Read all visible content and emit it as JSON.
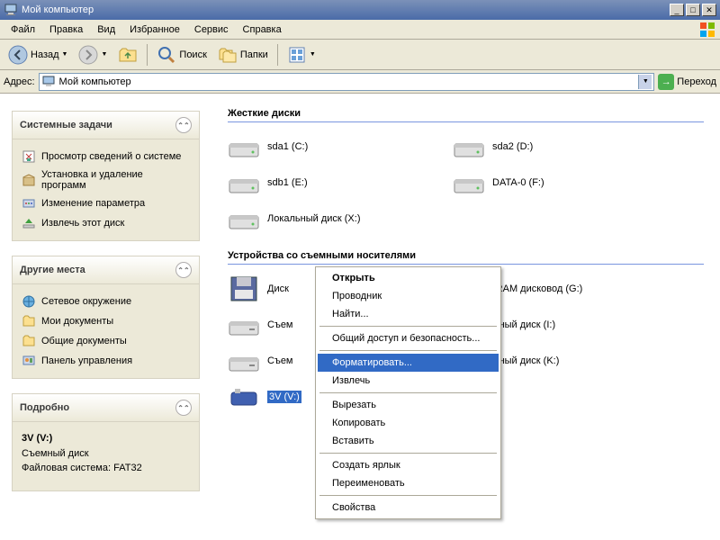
{
  "title": "Мой компьютер",
  "menu": [
    "Файл",
    "Правка",
    "Вид",
    "Избранное",
    "Сервис",
    "Справка"
  ],
  "toolbar": {
    "back": "Назад",
    "search": "Поиск",
    "folders": "Папки"
  },
  "address": {
    "label": "Адрес:",
    "value": "Мой компьютер",
    "go": "Переход"
  },
  "tasks": {
    "title": "Системные задачи",
    "items": [
      "Просмотр сведений о системе",
      "Установка и удаление программ",
      "Изменение параметра",
      "Извлечь этот диск"
    ]
  },
  "places": {
    "title": "Другие места",
    "items": [
      "Сетевое окружение",
      "Мои документы",
      "Общие документы",
      "Панель управления"
    ]
  },
  "details": {
    "title": "Подробно",
    "name": "3V (V:)",
    "type": "Съемный диск",
    "fs": "Файловая система: FAT32"
  },
  "groups": {
    "hdd": "Жесткие диски",
    "dev": "Устройства со съемными носителями"
  },
  "hdd": [
    {
      "label": "sda1 (C:)"
    },
    {
      "label": "sda2 (D:)"
    },
    {
      "label": "sdb1 (E:)"
    },
    {
      "label": "DATA-0 (F:)"
    },
    {
      "label": "Локальный диск (X:)"
    }
  ],
  "dev": [
    {
      "label": "Диск",
      "type": "floppy"
    },
    {
      "label": "-RAM дисковод (G:)",
      "type": "cd"
    },
    {
      "label": "Съем",
      "type": "rem"
    },
    {
      "label": "мный диск (I:)",
      "type": "rem"
    },
    {
      "label": "Съем",
      "type": "rem"
    },
    {
      "label": "мный диск (K:)",
      "type": "rem"
    },
    {
      "label": "3V (V:)",
      "type": "usb",
      "selected": true
    }
  ],
  "context": [
    {
      "label": "Открыть",
      "bold": true
    },
    {
      "label": "Проводник"
    },
    {
      "label": "Найти..."
    },
    {
      "sep": true
    },
    {
      "label": "Общий доступ и безопасность..."
    },
    {
      "sep": true
    },
    {
      "label": "Форматировать...",
      "hl": true
    },
    {
      "label": "Извлечь"
    },
    {
      "sep": true
    },
    {
      "label": "Вырезать"
    },
    {
      "label": "Копировать"
    },
    {
      "label": "Вставить"
    },
    {
      "sep": true
    },
    {
      "label": "Создать ярлык"
    },
    {
      "label": "Переименовать"
    },
    {
      "sep": true
    },
    {
      "label": "Свойства"
    }
  ]
}
